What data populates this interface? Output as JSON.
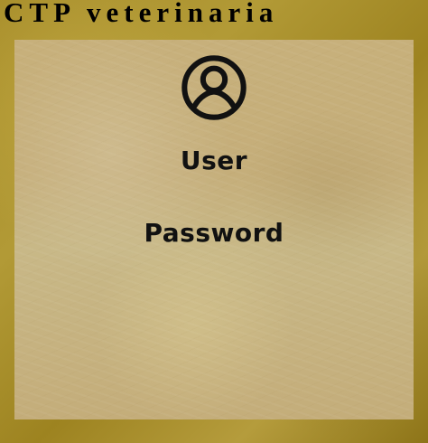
{
  "header": {
    "title": "CTP veterinaria"
  },
  "form": {
    "avatar_icon": "user-icon",
    "user_label": "User",
    "password_label": "Password"
  },
  "colors": {
    "outer_background": "#A88F2B",
    "panel_background": "#C7B07B",
    "text": "#111111"
  }
}
